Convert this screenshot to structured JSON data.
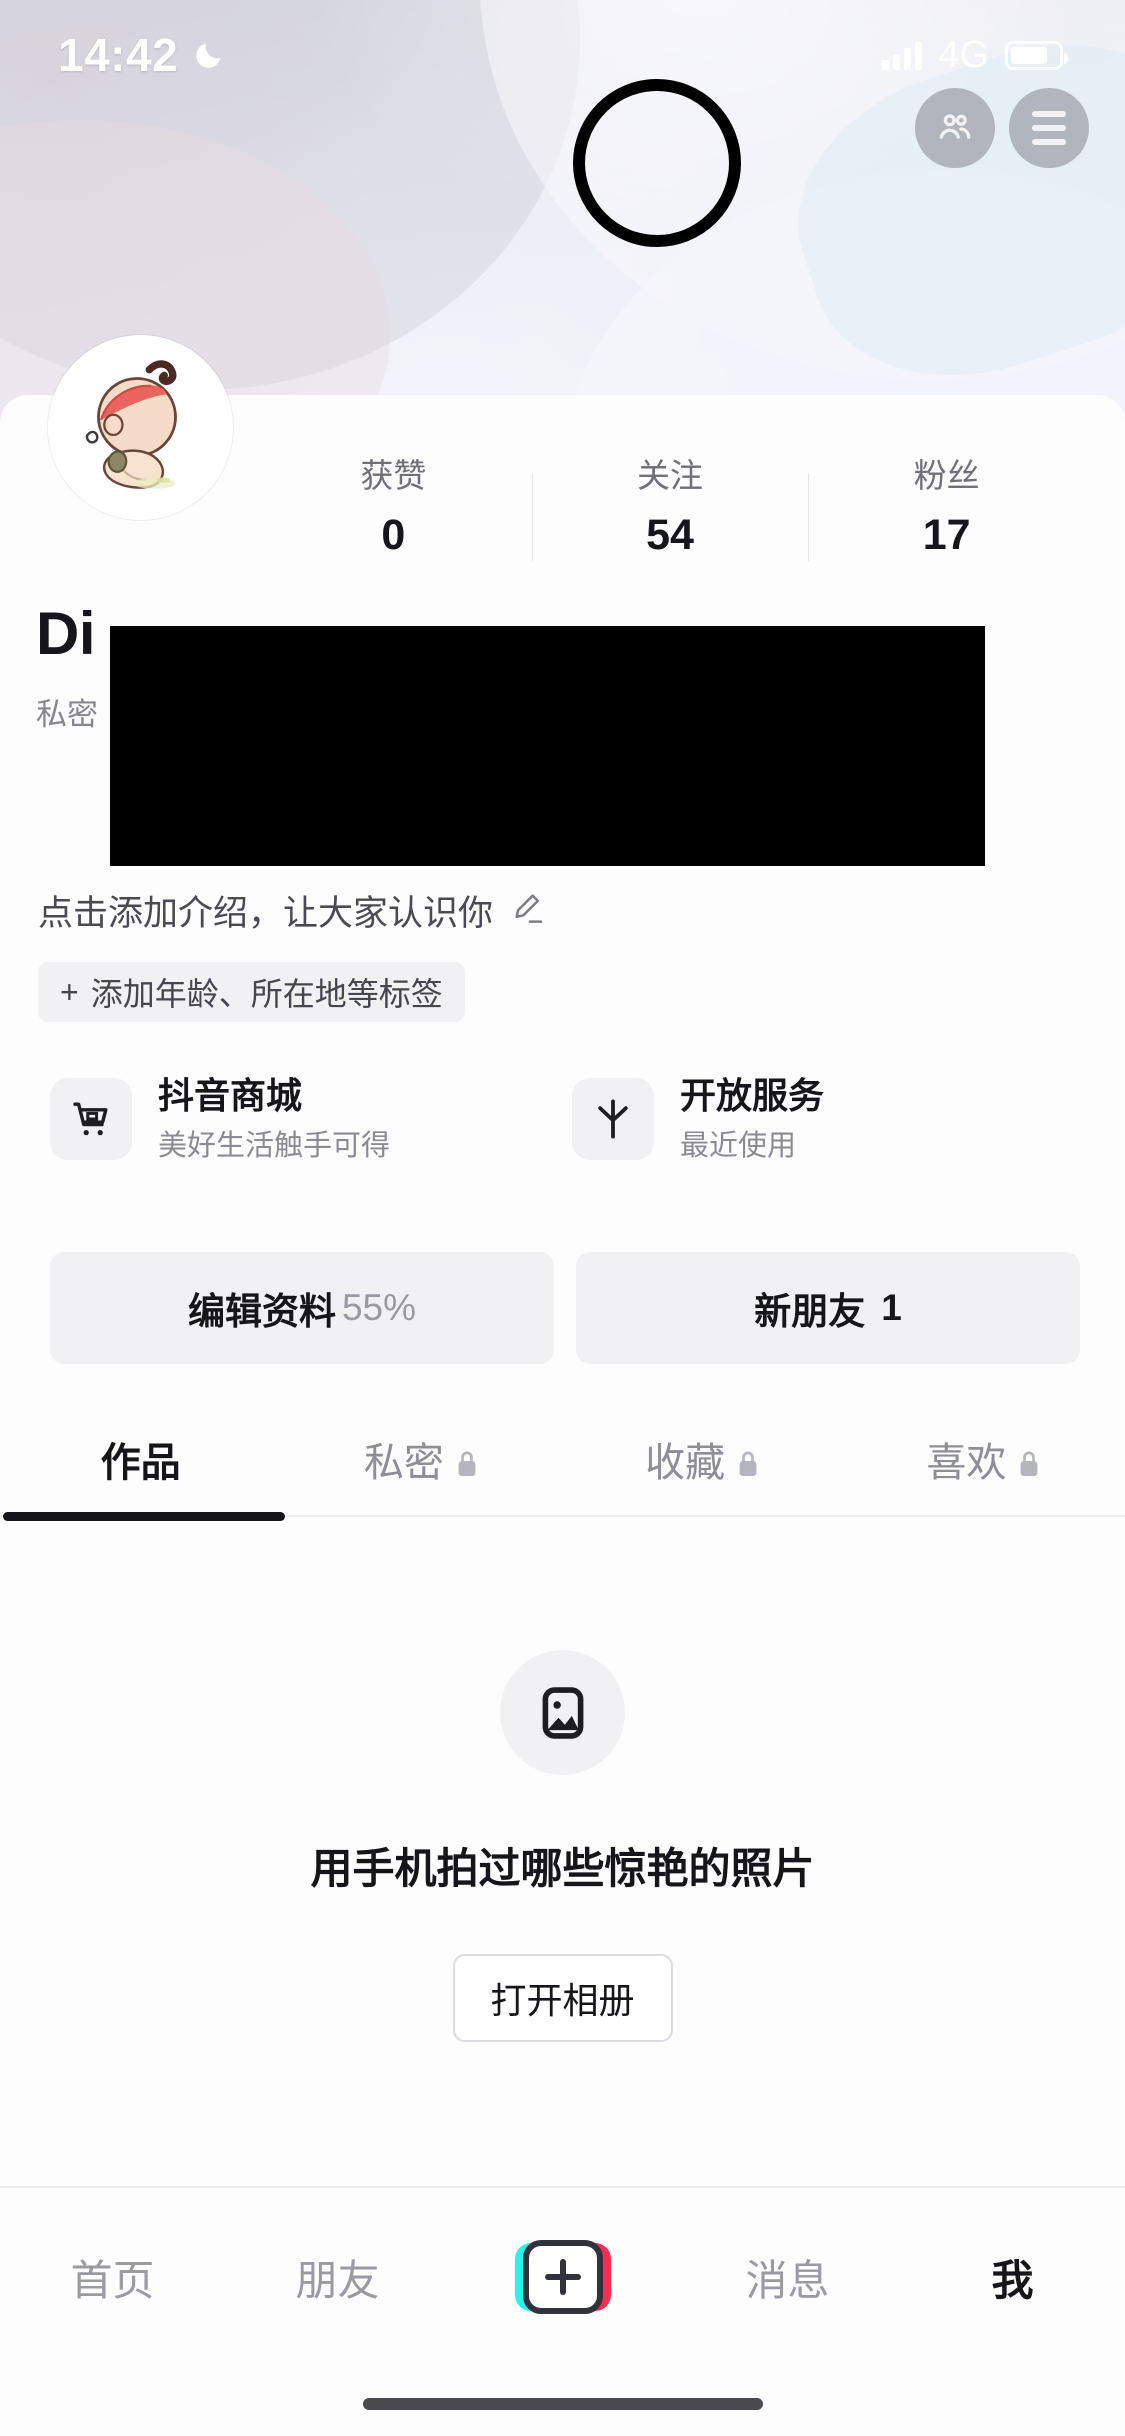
{
  "status_bar": {
    "time": "14:42",
    "moon_icon": "moon-icon",
    "signal_icon": "signal-bars-icon",
    "network": "4G",
    "battery_icon": "battery-icon"
  },
  "header": {
    "friends_button_icon": "people-icon",
    "menu_button_icon": "hamburger-menu-icon",
    "annotation": "highlight-circle"
  },
  "profile": {
    "avatar_icon": "user-avatar",
    "username": "Di",
    "privacy_label": "私密",
    "bio_placeholder": "点击添加介绍，让大家认识你",
    "bio_edit_icon": "pencil-icon",
    "tag_button": {
      "plus": "+",
      "label": "添加年龄、所在地等标签"
    }
  },
  "stats": [
    {
      "label": "获赞",
      "value": "0"
    },
    {
      "label": "关注",
      "value": "54"
    },
    {
      "label": "粉丝",
      "value": "17"
    }
  ],
  "services": [
    {
      "icon": "shopping-cart-icon",
      "title": "抖音商城",
      "subtitle": "美好生活触手可得"
    },
    {
      "icon": "sparkle-icon",
      "title": "开放服务",
      "subtitle": "最近使用"
    }
  ],
  "actions": [
    {
      "label": "编辑资料",
      "value": "55%"
    },
    {
      "label": "新朋友",
      "value": "1"
    }
  ],
  "tabs": [
    {
      "label": "作品",
      "locked": false
    },
    {
      "label": "私密",
      "locked": true
    },
    {
      "label": "收藏",
      "locked": true
    },
    {
      "label": "喜欢",
      "locked": true
    }
  ],
  "empty_state": {
    "icon": "image-placeholder-icon",
    "text": "用手机拍过哪些惊艳的照片",
    "button_label": "打开相册"
  },
  "bottom_nav": [
    {
      "label": "首页",
      "active": false
    },
    {
      "label": "朋友",
      "active": false
    },
    {
      "label": "+",
      "active": false,
      "icon": "add-post-icon"
    },
    {
      "label": "消息",
      "active": false
    },
    {
      "label": "我",
      "active": true
    }
  ],
  "colors": {
    "accent_cyan": "#25F4EE",
    "accent_pink": "#FE2C55",
    "text_primary": "#16161A",
    "text_secondary": "#8E8E96",
    "chip_bg": "#F1F1F3"
  }
}
